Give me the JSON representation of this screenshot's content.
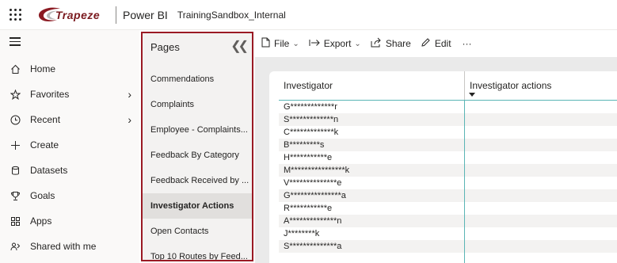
{
  "header": {
    "logo_text": "Trapeze",
    "product": "Power BI",
    "workspace": "TrainingSandbox_Internal"
  },
  "leftnav": {
    "items": [
      {
        "label": "Home",
        "icon": "home-icon"
      },
      {
        "label": "Favorites",
        "icon": "star-icon",
        "chevron": true
      },
      {
        "label": "Recent",
        "icon": "clock-icon",
        "chevron": true
      },
      {
        "label": "Create",
        "icon": "plus-icon"
      },
      {
        "label": "Datasets",
        "icon": "database-icon"
      },
      {
        "label": "Goals",
        "icon": "trophy-icon"
      },
      {
        "label": "Apps",
        "icon": "apps-icon"
      },
      {
        "label": "Shared with me",
        "icon": "shared-icon"
      }
    ]
  },
  "pages": {
    "title": "Pages",
    "items": [
      {
        "label": "Commendations"
      },
      {
        "label": "Complaints"
      },
      {
        "label": "Employee - Complaints..."
      },
      {
        "label": "Feedback By Category"
      },
      {
        "label": "Feedback Received by ..."
      },
      {
        "label": "Investigator Actions",
        "active": true
      },
      {
        "label": "Open Contacts"
      },
      {
        "label": "Top 10 Routes by Feed..."
      }
    ]
  },
  "toolbar": {
    "file": "File",
    "export": "Export",
    "share": "Share",
    "edit": "Edit",
    "more": "···"
  },
  "table": {
    "columns": [
      "Investigator",
      "Investigator actions"
    ],
    "rows": [
      "G*************r",
      "S*************n",
      "C*************k",
      "B*********s",
      "H***********e",
      "M****************k",
      "V**************e",
      "G***************a",
      "R***********e",
      "A**************n",
      "J********k",
      "S**************a"
    ]
  },
  "colors": {
    "accent_border": "#9a1a24",
    "logo": "#7a1a1f",
    "table_rule": "#5ab5b5"
  }
}
